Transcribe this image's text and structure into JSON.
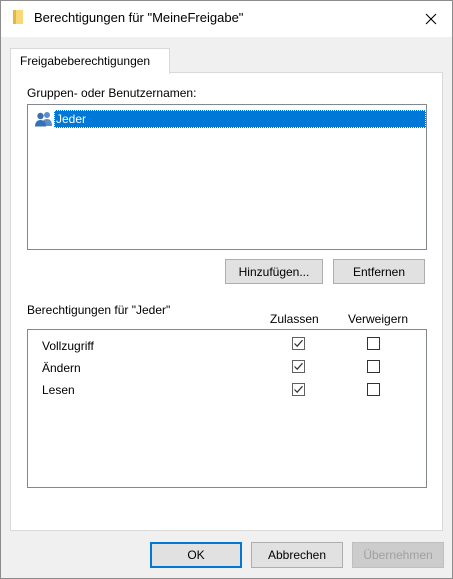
{
  "window": {
    "title": "Berechtigungen für \"MeineFreigabe\""
  },
  "tabs": [
    {
      "label": "Freigabeberechtigungen",
      "active": true
    }
  ],
  "groups": {
    "label": "Gruppen- oder Benutzernamen:",
    "items": [
      {
        "name": "Jeder",
        "selected": true,
        "icon": "users-group-icon"
      }
    ],
    "add_button": "Hinzufügen...",
    "remove_button": "Entfernen"
  },
  "permissions": {
    "label": "Berechtigungen für \"Jeder\"",
    "columns": [
      "Zulassen",
      "Verweigern"
    ],
    "rows": [
      {
        "name": "Vollzugriff",
        "allow": true,
        "deny": false
      },
      {
        "name": "Ändern",
        "allow": true,
        "deny": false
      },
      {
        "name": "Lesen",
        "allow": true,
        "deny": false
      }
    ]
  },
  "footer": {
    "ok": "OK",
    "cancel": "Abbrechen",
    "apply": "Übernehmen",
    "apply_disabled": true
  },
  "colors": {
    "selection": "#0078d7",
    "dialog_bg": "#f0f0f0",
    "folder": "#f8d775"
  }
}
